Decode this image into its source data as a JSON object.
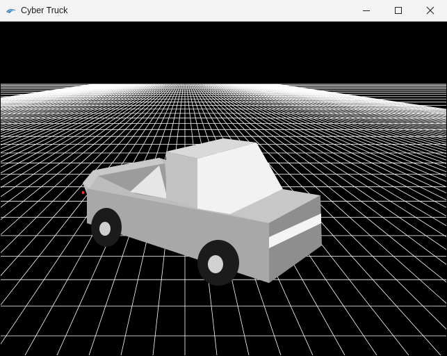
{
  "window": {
    "title": "Cyber Truck",
    "app_icon": "app-logo-icon",
    "controls": {
      "minimize": "minimize-icon",
      "maximize": "maximize-icon",
      "close": "close-icon"
    }
  },
  "scene": {
    "background_color": "#000000",
    "grid_color": "#ffffff",
    "object": "pickup-truck-model",
    "body_color": "#b8b8b8",
    "tire_color": "#1a1a1a"
  }
}
